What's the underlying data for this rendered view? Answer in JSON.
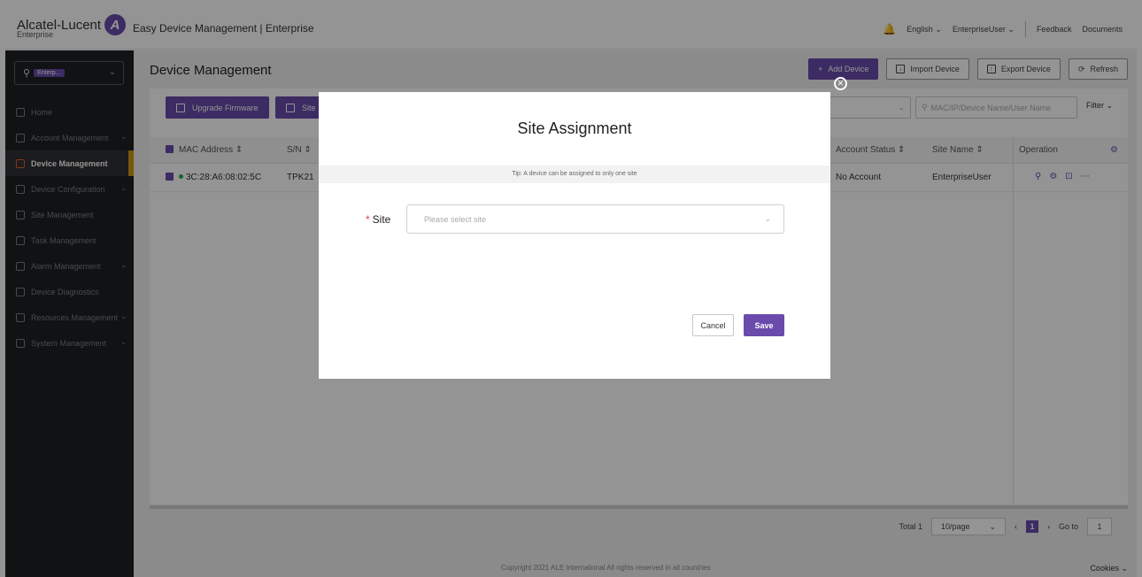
{
  "header": {
    "logo_text": "Alcatel-Lucent",
    "logo_sub": "Enterprise",
    "app_title": "Easy Device Management | Enterprise",
    "language": "English",
    "user": "EnterpriseUser",
    "feedback": "Feedback",
    "documents": "Documents"
  },
  "sidebar": {
    "search_chip": "Enterp...",
    "items": [
      {
        "label": "Home"
      },
      {
        "label": "Account Management"
      },
      {
        "label": "Device Management"
      },
      {
        "label": "Device Configuration"
      },
      {
        "label": "Site Management"
      },
      {
        "label": "Task Management"
      },
      {
        "label": "Alarm Management"
      },
      {
        "label": "Device Diagnostics"
      },
      {
        "label": "Resources Management"
      },
      {
        "label": "System Management"
      }
    ]
  },
  "main": {
    "title": "Device Management",
    "add_device": "Add Device",
    "import_device": "Import Device",
    "export_device": "Export Device",
    "refresh": "Refresh",
    "upgrade_firmware": "Upgrade Firmware",
    "site_btn": "Site",
    "search_placeholder": "MAC/IP/Device Name/User Name",
    "filter": "Filter",
    "columns": {
      "mac": "MAC Address",
      "sn": "S/N",
      "account_status": "Account Status",
      "site_name": "Site Name",
      "operation": "Operation"
    },
    "rows": [
      {
        "mac": "3C:28:A6:08:02:5C",
        "sn": "TPK21",
        "account_status": "No Account",
        "site_name": "EnterpriseUser"
      }
    ],
    "pager": {
      "total": "Total 1",
      "page_size": "10/page",
      "current": "1",
      "goto_label": "Go to",
      "goto_value": "1"
    },
    "copyright": "Copyright 2021 ALE International All rights reserved in all countries",
    "cookies": "Cookies"
  },
  "modal": {
    "title": "Site Assignment",
    "tip": "Tip: A device can be assigned to only one site",
    "site_label": "Site",
    "site_placeholder": "Please select site",
    "cancel": "Cancel",
    "save": "Save"
  },
  "colors": {
    "brand": "#6a4bab",
    "sidebar_bg": "#1d1f22",
    "active_marker": "#c89a12",
    "online": "#2ea84a"
  }
}
